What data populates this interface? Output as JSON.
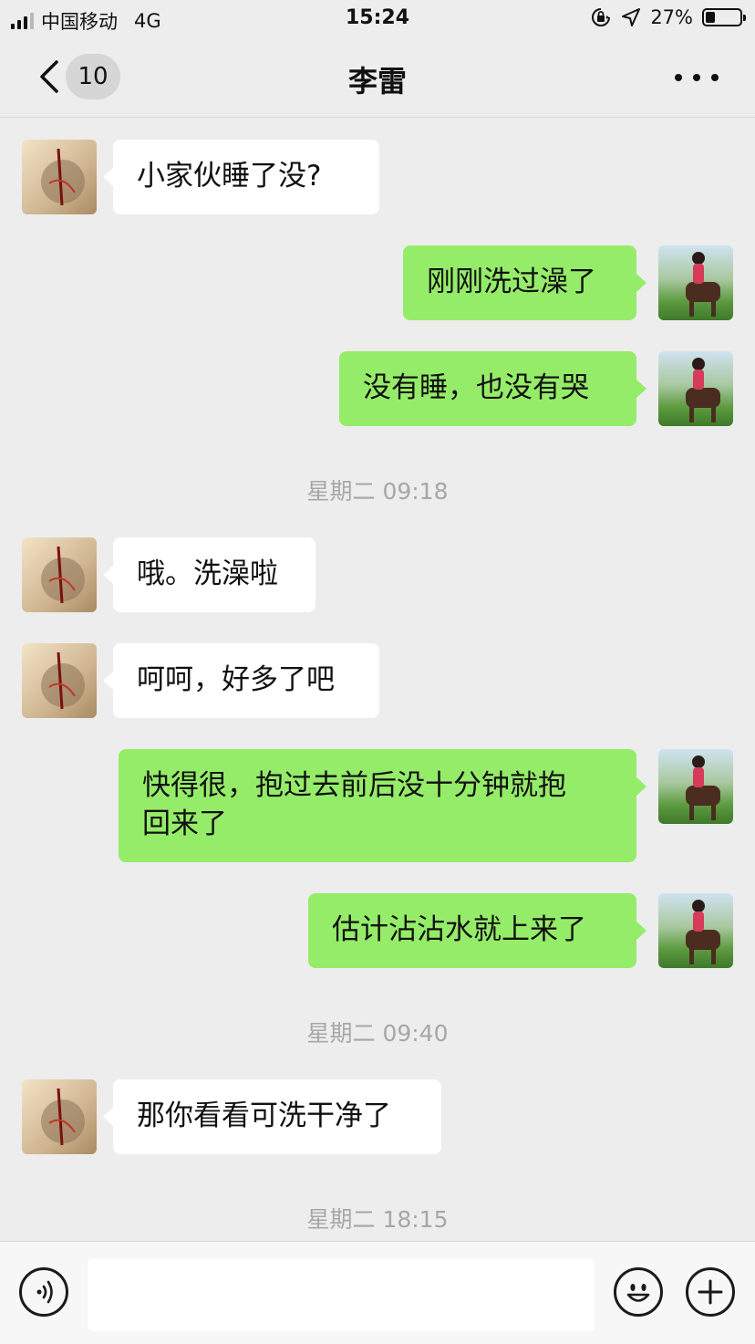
{
  "status_bar": {
    "carrier": "中国移动",
    "network": "4G",
    "time": "15:24",
    "battery_percent": "27%",
    "battery_level": 0.27,
    "icons": [
      "signal-icon",
      "orientation-lock-icon",
      "location-icon",
      "battery-icon"
    ]
  },
  "nav": {
    "back_icon": "chevron-left-icon",
    "unread_count": "10",
    "title": "李雷",
    "more_icon": "more-dots-icon"
  },
  "messages": [
    {
      "sender": "other",
      "text": "小家伙睡了没?"
    },
    {
      "sender": "self",
      "text": "刚刚洗过澡了"
    },
    {
      "sender": "self",
      "text": "没有睡，也没有哭"
    },
    {
      "type": "timestamp",
      "text": "星期二 09:18"
    },
    {
      "sender": "other",
      "text": "哦。洗澡啦"
    },
    {
      "sender": "other",
      "text": "呵呵，好多了吧"
    },
    {
      "sender": "self",
      "text": "快得很，抱过去前后没十分钟就抱\n回来了"
    },
    {
      "sender": "self",
      "text": "估计沾沾水就上来了"
    },
    {
      "type": "timestamp",
      "text": "星期二 09:40"
    },
    {
      "sender": "other",
      "text": "那你看看可洗干净了"
    },
    {
      "type": "timestamp",
      "text": "星期二 18:15"
    }
  ],
  "input_bar": {
    "voice_icon": "voice-icon",
    "text_value": "",
    "emoji_icon": "emoji-icon",
    "plus_icon": "plus-icon"
  },
  "colors": {
    "background": "#ededed",
    "bubble_out": "#95ec69",
    "bubble_in": "#ffffff",
    "timestamp": "#a7a7a7"
  }
}
